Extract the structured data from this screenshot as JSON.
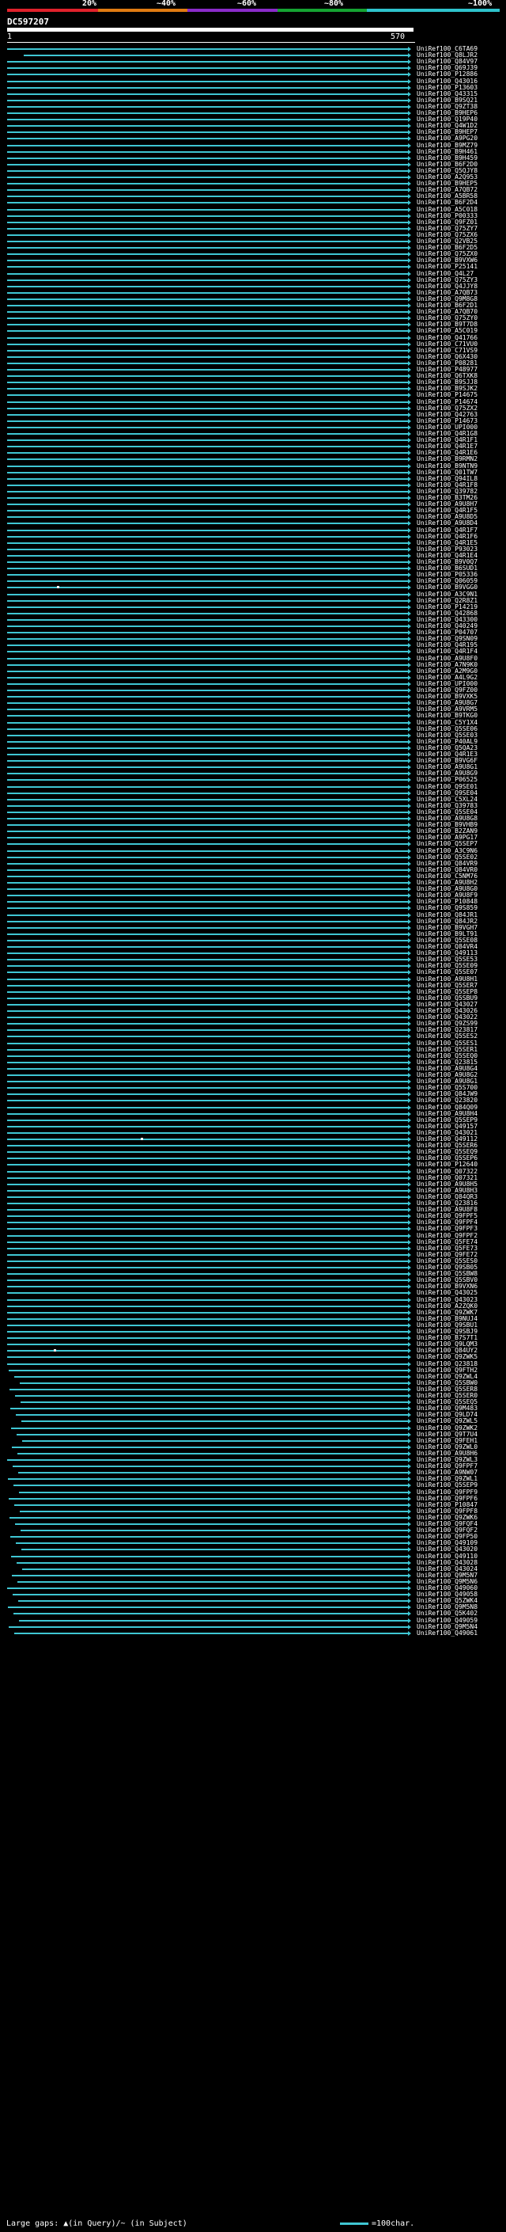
{
  "scale": {
    "labels": [
      "20%",
      "~40%",
      "~60%",
      "~80%",
      "~100%"
    ],
    "colors": [
      "#e0212b",
      "#e07b12",
      "#8a2bc9",
      "#15a332",
      "#2ec3cc"
    ]
  },
  "query": {
    "id": "DC597207",
    "start": "1",
    "end": "570"
  },
  "footer": {
    "gaps_text": "Large gaps: ▲(in Query)/~ (in Subject)",
    "legend_text": "=100char."
  },
  "hits": [
    "UniRef100_C6TA69",
    "UniRef100_Q8LJR2",
    "UniRef100_Q84V97",
    "UniRef100_Q69J39",
    "UniRef100_P12886",
    "UniRef100_Q43016",
    "UniRef100_P13603",
    "UniRef100_Q43315",
    "UniRef100_B9SQ21",
    "UniRef100_Q9ZT38",
    "UniRef100_B9HEP6",
    "UniRef100_Q19P40",
    "UniRef100_Q4W1D2",
    "UniRef100_B9HEP7",
    "UniRef100_A9PG20",
    "UniRef100_B9MZ79",
    "UniRef100_B9H461",
    "UniRef100_B9H459",
    "UniRef100_B6F2D0",
    "UniRef100_Q5QJY8",
    "UniRef100_A2Q953",
    "UniRef100_B9HEP5",
    "UniRef100_A7QB72",
    "UniRef100_A5BR58",
    "UniRef100_B6F2D4",
    "UniRef100_A5C018",
    "UniRef100_P00333",
    "UniRef100_Q9FZ01",
    "UniRef100_Q75ZY7",
    "UniRef100_Q75ZX6",
    "UniRef100_Q2VB25",
    "UniRef100_B6F2D5",
    "UniRef100_Q75ZX0",
    "UniRef100_B9VXW6",
    "UniRef100_P25141",
    "UniRef100_Q4L27",
    "UniRef100_Q75ZY3",
    "UniRef100_Q4JJY8",
    "UniRef100_A7QB73",
    "UniRef100_Q9M8G8",
    "UniRef100_B6F2D1",
    "UniRef100_A7QB70",
    "UniRef100_Q75ZY0",
    "UniRef100_B9T7D8",
    "UniRef100_A5C019",
    "UniRef100_Q41766",
    "UniRef100_C71VU0",
    "UniRef100_C71VS9",
    "UniRef100_Q6X430",
    "UniRef100_P08281",
    "UniRef100_P48977",
    "UniRef100_Q6TXK8",
    "UniRef100_B9SJJ8",
    "UniRef100_B9SJK2",
    "UniRef100_P14675",
    "UniRef100_P14674",
    "UniRef100_Q75ZX2",
    "UniRef100_Q42763",
    "UniRef100_P14673",
    "UniRef100_UPI000",
    "UniRef100_Q4R1G8",
    "UniRef100_Q4R1F1",
    "UniRef100_Q4R1E7",
    "UniRef100_Q4R1E6",
    "UniRef100_B9RMN2",
    "UniRef100_B9NTN9",
    "UniRef100_Q01TW7",
    "UniRef100_Q94IL8",
    "UniRef100_Q4R1F8",
    "UniRef100_Q39782",
    "UniRef100_B3TM26",
    "UniRef100_A9U8H7",
    "UniRef100_Q4R1F5",
    "UniRef100_A9U8D5",
    "UniRef100_A9U8D4",
    "UniRef100_Q4R1F7",
    "UniRef100_Q4R1F6",
    "UniRef100_Q4R1E5",
    "UniRef100_P93023",
    "UniRef100_Q4R1E4",
    "UniRef100_B9V0Q7",
    "UniRef100_B6SUD1",
    "UniRef100_P05336",
    "UniRef100_Q06059",
    "UniRef100_B9VGG0",
    "UniRef100_A3C9N1",
    "UniRef100_Q2R8Z1",
    "UniRef100_P14219",
    "UniRef100_Q42868",
    "UniRef100_Q43300",
    "UniRef100_Q40249",
    "UniRef100_P04707",
    "UniRef100_Q9SN09",
    "UniRef100_Q4R195",
    "UniRef100_Q4R1F4",
    "UniRef100_A9U8F0",
    "UniRef100_A7N9K0",
    "UniRef100_A2M9G0",
    "UniRef100_A4L9G2",
    "UniRef100_UPI000",
    "UniRef100_Q9FZ00",
    "UniRef100_B9VXK5",
    "UniRef100_A9U8G7",
    "UniRef100_A9VRM5",
    "UniRef100_B9TKG0",
    "UniRef100_C5Y1X4",
    "UniRef100_Q5SE06",
    "UniRef100_Q5SE03",
    "UniRef100_P40AL9",
    "UniRef100_Q5QA23",
    "UniRef100_Q4R1E3",
    "UniRef100_B9VG6F",
    "UniRef100_A9U8G1",
    "UniRef100_A9U8G9",
    "UniRef100_P06525",
    "UniRef100_Q9SE01",
    "UniRef100_Q9SE04",
    "UniRef100_C5XL24",
    "UniRef100_Q39783",
    "UniRef100_Q5SE04",
    "UniRef100_A9U8G8",
    "UniRef100_B9VHB9",
    "UniRef100_B2ZAN9",
    "UniRef100_A9PG17",
    "UniRef100_Q5SEP7",
    "UniRef100_A3C9N6",
    "UniRef100_Q5SE02",
    "UniRef100_Q84VR9",
    "UniRef100_Q84VR0",
    "UniRef100_C5NM76",
    "UniRef100_A9U8H2",
    "UniRef100_A9U8G0",
    "UniRef100_A9U8F9",
    "UniRef100_P10848",
    "UniRef100_Q9S859",
    "UniRef100_Q84JR1",
    "UniRef100_Q84JR2",
    "UniRef100_B9VGH7",
    "UniRef100_B9LT91",
    "UniRef100_Q5SE08",
    "UniRef100_Q84VR4",
    "UniRef100_Q49113",
    "UniRef100_Q5SE53",
    "UniRef100_Q5SE09",
    "UniRef100_Q5SE07",
    "UniRef100_A9U8H1",
    "UniRef100_Q5SER7",
    "UniRef100_Q5SEP8",
    "UniRef100_Q5SBU9",
    "UniRef100_Q43027",
    "UniRef100_Q43026",
    "UniRef100_Q43022",
    "UniRef100_Q9ZS99",
    "UniRef100_Q23817",
    "UniRef100_Q5SES2",
    "UniRef100_Q5SES1",
    "UniRef100_Q5SER1",
    "UniRef100_Q5SEQ0",
    "UniRef100_Q23815",
    "UniRef100_A9U8G4",
    "UniRef100_A9U8G2",
    "UniRef100_A9U8G1",
    "UniRef100_Q5S700",
    "UniRef100_Q84JW9",
    "UniRef100_Q23820",
    "UniRef100_Q84Q09",
    "UniRef100_A9U8H4",
    "UniRef100_Q5SEP9",
    "UniRef100_Q49157",
    "UniRef100_Q43021",
    "UniRef100_Q49112",
    "UniRef100_Q5SER6",
    "UniRef100_Q5SEQ9",
    "UniRef100_Q5SEP6",
    "UniRef100_P12640",
    "UniRef100_Q07322",
    "UniRef100_Q07321",
    "UniRef100_A9U8H5",
    "UniRef100_A9U8H3",
    "UniRef100_Q84QR3",
    "UniRef100_Q23816",
    "UniRef100_A9U8F8",
    "UniRef100_Q9FPF5",
    "UniRef100_Q9FPF4",
    "UniRef100_Q9FPF3",
    "UniRef100_Q9FPF2",
    "UniRef100_Q5FE74",
    "UniRef100_Q5FE73",
    "UniRef100_Q9FE72",
    "UniRef100_Q5SES0",
    "UniRef100_Q9SB05",
    "UniRef100_Q5SBW8",
    "UniRef100_Q5SBV0",
    "UniRef100_B9VXN6",
    "UniRef100_Q43025",
    "UniRef100_Q43023",
    "UniRef100_A2ZQK0",
    "UniRef100_Q9ZWK7",
    "UniRef100_B9NUJ4",
    "UniRef100_Q9SBU1",
    "UniRef100_Q9SBJ9",
    "UniRef100_B7S7T1",
    "UniRef100_Q9LQM3",
    "UniRef100_Q84UY2",
    "UniRef100_Q9ZWK5",
    "UniRef100_Q23818",
    "UniRef100_Q9FTH2",
    "UniRef100_Q9ZWL4",
    "UniRef100_Q5SBW0",
    "UniRef100_Q5SER8",
    "UniRef100_Q5SER0",
    "UniRef100_Q5SEQ5",
    "UniRef100_Q9M483",
    "UniRef100_Q9LD74",
    "UniRef100_Q9ZWL5",
    "UniRef100_Q9ZWK2",
    "UniRef100_Q9T7U4",
    "UniRef100_Q9FEH1",
    "UniRef100_Q9ZWL0",
    "UniRef100_A9U8H6",
    "UniRef100_Q9ZWL3",
    "UniRef100_Q9FPF7",
    "UniRef100_A9NW07",
    "UniRef100_Q9ZWL1",
    "UniRef100_Q5SEP9",
    "UniRef100_Q9FPF9",
    "UniRef100_Q9FPF6",
    "UniRef100_P10847",
    "UniRef100_Q9FPF8",
    "UniRef100_Q9ZWK6",
    "UniRef100_Q9FQF4",
    "UniRef100_Q9FQF2",
    "UniRef100_Q9FP50",
    "UniRef100_Q49109",
    "UniRef100_Q43020",
    "UniRef100_Q49110",
    "UniRef100_Q43028",
    "UniRef100_Q43024",
    "UniRef100_Q9M5N7",
    "UniRef100_Q9M5N6",
    "UniRef100_Q49060",
    "UniRef100_Q49058",
    "UniRef100_Q5ZWK4",
    "UniRef100_Q9M5N8",
    "UniRef100_Q5K402",
    "UniRef100_Q49059",
    "UniRef100_Q9M5N4",
    "UniRef100_Q49061"
  ]
}
